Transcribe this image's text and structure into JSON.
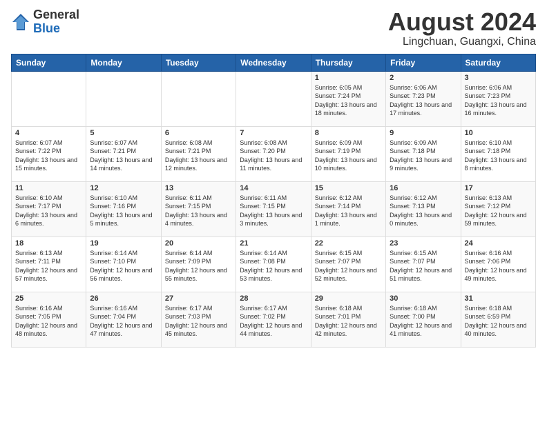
{
  "header": {
    "logo_general": "General",
    "logo_blue": "Blue",
    "month_title": "August 2024",
    "location": "Lingchuan, Guangxi, China"
  },
  "weekdays": [
    "Sunday",
    "Monday",
    "Tuesday",
    "Wednesday",
    "Thursday",
    "Friday",
    "Saturday"
  ],
  "weeks": [
    [
      {
        "day": "",
        "info": ""
      },
      {
        "day": "",
        "info": ""
      },
      {
        "day": "",
        "info": ""
      },
      {
        "day": "",
        "info": ""
      },
      {
        "day": "1",
        "info": "Sunrise: 6:05 AM\nSunset: 7:24 PM\nDaylight: 13 hours and 18 minutes."
      },
      {
        "day": "2",
        "info": "Sunrise: 6:06 AM\nSunset: 7:23 PM\nDaylight: 13 hours and 17 minutes."
      },
      {
        "day": "3",
        "info": "Sunrise: 6:06 AM\nSunset: 7:23 PM\nDaylight: 13 hours and 16 minutes."
      }
    ],
    [
      {
        "day": "4",
        "info": "Sunrise: 6:07 AM\nSunset: 7:22 PM\nDaylight: 13 hours and 15 minutes."
      },
      {
        "day": "5",
        "info": "Sunrise: 6:07 AM\nSunset: 7:21 PM\nDaylight: 13 hours and 14 minutes."
      },
      {
        "day": "6",
        "info": "Sunrise: 6:08 AM\nSunset: 7:21 PM\nDaylight: 13 hours and 12 minutes."
      },
      {
        "day": "7",
        "info": "Sunrise: 6:08 AM\nSunset: 7:20 PM\nDaylight: 13 hours and 11 minutes."
      },
      {
        "day": "8",
        "info": "Sunrise: 6:09 AM\nSunset: 7:19 PM\nDaylight: 13 hours and 10 minutes."
      },
      {
        "day": "9",
        "info": "Sunrise: 6:09 AM\nSunset: 7:18 PM\nDaylight: 13 hours and 9 minutes."
      },
      {
        "day": "10",
        "info": "Sunrise: 6:10 AM\nSunset: 7:18 PM\nDaylight: 13 hours and 8 minutes."
      }
    ],
    [
      {
        "day": "11",
        "info": "Sunrise: 6:10 AM\nSunset: 7:17 PM\nDaylight: 13 hours and 6 minutes."
      },
      {
        "day": "12",
        "info": "Sunrise: 6:10 AM\nSunset: 7:16 PM\nDaylight: 13 hours and 5 minutes."
      },
      {
        "day": "13",
        "info": "Sunrise: 6:11 AM\nSunset: 7:15 PM\nDaylight: 13 hours and 4 minutes."
      },
      {
        "day": "14",
        "info": "Sunrise: 6:11 AM\nSunset: 7:15 PM\nDaylight: 13 hours and 3 minutes."
      },
      {
        "day": "15",
        "info": "Sunrise: 6:12 AM\nSunset: 7:14 PM\nDaylight: 13 hours and 1 minute."
      },
      {
        "day": "16",
        "info": "Sunrise: 6:12 AM\nSunset: 7:13 PM\nDaylight: 13 hours and 0 minutes."
      },
      {
        "day": "17",
        "info": "Sunrise: 6:13 AM\nSunset: 7:12 PM\nDaylight: 12 hours and 59 minutes."
      }
    ],
    [
      {
        "day": "18",
        "info": "Sunrise: 6:13 AM\nSunset: 7:11 PM\nDaylight: 12 hours and 57 minutes."
      },
      {
        "day": "19",
        "info": "Sunrise: 6:14 AM\nSunset: 7:10 PM\nDaylight: 12 hours and 56 minutes."
      },
      {
        "day": "20",
        "info": "Sunrise: 6:14 AM\nSunset: 7:09 PM\nDaylight: 12 hours and 55 minutes."
      },
      {
        "day": "21",
        "info": "Sunrise: 6:14 AM\nSunset: 7:08 PM\nDaylight: 12 hours and 53 minutes."
      },
      {
        "day": "22",
        "info": "Sunrise: 6:15 AM\nSunset: 7:07 PM\nDaylight: 12 hours and 52 minutes."
      },
      {
        "day": "23",
        "info": "Sunrise: 6:15 AM\nSunset: 7:07 PM\nDaylight: 12 hours and 51 minutes."
      },
      {
        "day": "24",
        "info": "Sunrise: 6:16 AM\nSunset: 7:06 PM\nDaylight: 12 hours and 49 minutes."
      }
    ],
    [
      {
        "day": "25",
        "info": "Sunrise: 6:16 AM\nSunset: 7:05 PM\nDaylight: 12 hours and 48 minutes."
      },
      {
        "day": "26",
        "info": "Sunrise: 6:16 AM\nSunset: 7:04 PM\nDaylight: 12 hours and 47 minutes."
      },
      {
        "day": "27",
        "info": "Sunrise: 6:17 AM\nSunset: 7:03 PM\nDaylight: 12 hours and 45 minutes."
      },
      {
        "day": "28",
        "info": "Sunrise: 6:17 AM\nSunset: 7:02 PM\nDaylight: 12 hours and 44 minutes."
      },
      {
        "day": "29",
        "info": "Sunrise: 6:18 AM\nSunset: 7:01 PM\nDaylight: 12 hours and 42 minutes."
      },
      {
        "day": "30",
        "info": "Sunrise: 6:18 AM\nSunset: 7:00 PM\nDaylight: 12 hours and 41 minutes."
      },
      {
        "day": "31",
        "info": "Sunrise: 6:18 AM\nSunset: 6:59 PM\nDaylight: 12 hours and 40 minutes."
      }
    ]
  ]
}
